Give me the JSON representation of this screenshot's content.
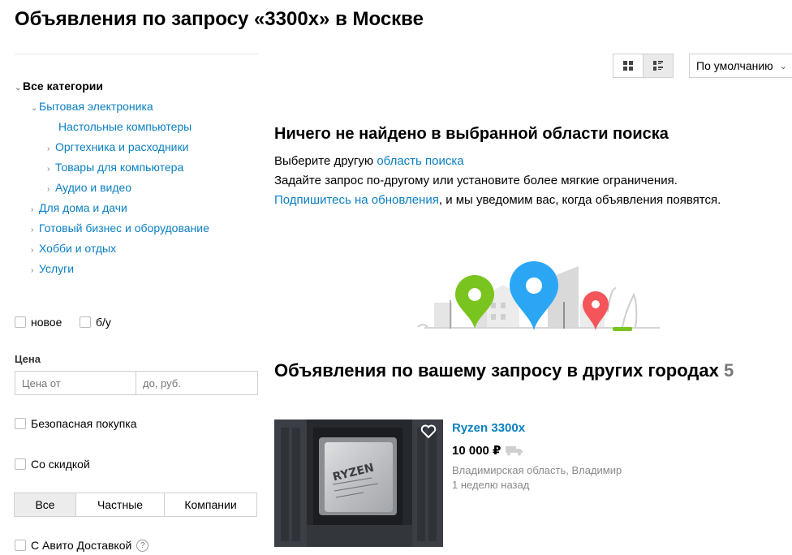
{
  "page_title": "Объявления по запросу «3300x» в Москве",
  "categories": {
    "root": "Все категории",
    "group": "Бытовая электроника",
    "sub": [
      {
        "label": "Настольные компьютеры"
      },
      {
        "label": "Оргтехника и расходники"
      },
      {
        "label": "Товары для компьютера"
      },
      {
        "label": "Аудио и видео"
      }
    ],
    "others": [
      {
        "label": "Для дома и дачи"
      },
      {
        "label": "Готовый бизнес и оборудование"
      },
      {
        "label": "Хобби и отдых"
      },
      {
        "label": "Услуги"
      }
    ]
  },
  "filters": {
    "condition_new": "новое",
    "condition_used": "б/у",
    "price_label": "Цена",
    "price_from_placeholder": "Цена от",
    "price_to_placeholder": "до, руб.",
    "safe_purchase": "Безопасная покупка",
    "discount": "Со скидкой",
    "seller_all": "Все",
    "seller_private": "Частные",
    "seller_companies": "Компании",
    "avito_delivery": "С Авито Доставкой",
    "help_glyph": "?"
  },
  "toolbar": {
    "sort_value": "По умолчанию"
  },
  "empty": {
    "heading": "Ничего не найдено в выбранной области поиска",
    "line1_prefix": "Выберите другую ",
    "line1_link": "область поиска",
    "line2": "Задайте запрос по-другому или установите более мягкие ограничения.",
    "line3_link": "Подпишитесь на обновления",
    "line3_suffix": ", и мы уведомим вас, когда объявления появятся."
  },
  "other_cities": {
    "heading": "Объявления по вашему запросу в других городах",
    "count": "5"
  },
  "listing": {
    "title": "Ryzen 3300x",
    "price": "10 000 ₽",
    "location": "Владимирская область, Владимир",
    "date": "1 неделю назад",
    "chip_text": "RYZEN"
  },
  "colors": {
    "link": "#0a7fc2",
    "pin_green": "#7ac41f",
    "pin_blue": "#2aa6f5",
    "pin_red": "#f4555a"
  }
}
